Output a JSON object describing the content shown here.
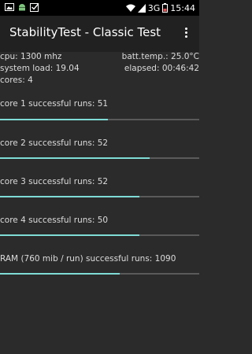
{
  "status_bar": {
    "network": "3G",
    "time": "15:44",
    "icons": [
      "image-icon",
      "android-icon",
      "checkbox-icon",
      "wifi-icon",
      "signal-icon",
      "battery-icon"
    ]
  },
  "app_bar": {
    "title": "StabilityTest - Classic Test",
    "menu_icon": "overflow-menu-icon"
  },
  "info": {
    "cpu": "cpu: 1300 mhz",
    "batt_temp": "batt.temp.: 25.0°C",
    "system_load": "system load: 19.04",
    "elapsed": "elapsed: 00:46:42",
    "cores": "cores: 4"
  },
  "progress_sections": [
    {
      "label": "core 1 successful runs: 51",
      "progress": 0.54
    },
    {
      "label": "core 2 successful runs: 52",
      "progress": 0.75
    },
    {
      "label": "core 3 successful runs: 52",
      "progress": 0.7
    },
    {
      "label": "core 4 successful runs: 50",
      "progress": 0.7
    },
    {
      "label": "RAM (760 mib / run) successful runs: 1090",
      "progress": 0.6
    }
  ],
  "colors": {
    "status_bar": "#000000",
    "app_bar": "#212121",
    "background": "#2b2b2b",
    "progress_fill": "#7fdcd6",
    "progress_track": "#5a5a5a"
  }
}
